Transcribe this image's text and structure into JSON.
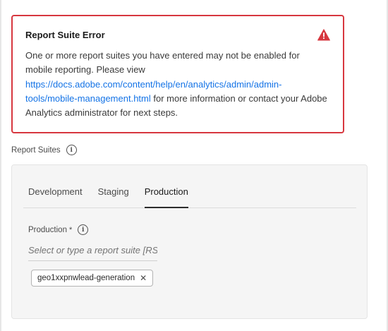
{
  "alert": {
    "title": "Report Suite Error",
    "icon": "alert-triangle-icon",
    "text_before": "One or more report suites you have entered may not be enabled for mobile reporting.  Please view ",
    "link": "https://docs.adobe.com/content/help/en/analytics/admin/admin-tools/mobile-management.html",
    "text_after": " for more information or contact your Adobe Analytics administrator for next steps.",
    "color": "#d7373f"
  },
  "report_suites": {
    "label": "Report Suites",
    "info_icon": "i"
  },
  "tabs": [
    {
      "label": "Development",
      "active": false
    },
    {
      "label": "Staging",
      "active": false
    },
    {
      "label": "Production",
      "active": true
    }
  ],
  "production_field": {
    "label": "Production",
    "required_marker": "*",
    "info_icon": "i",
    "placeholder": "Select or type a report suite [RSID]",
    "tags": [
      {
        "label": "geo1xxpnwlead-generation",
        "close": "✕"
      }
    ]
  },
  "colors": {
    "link": "#1473e6",
    "panel_bg": "#f5f5f5"
  }
}
